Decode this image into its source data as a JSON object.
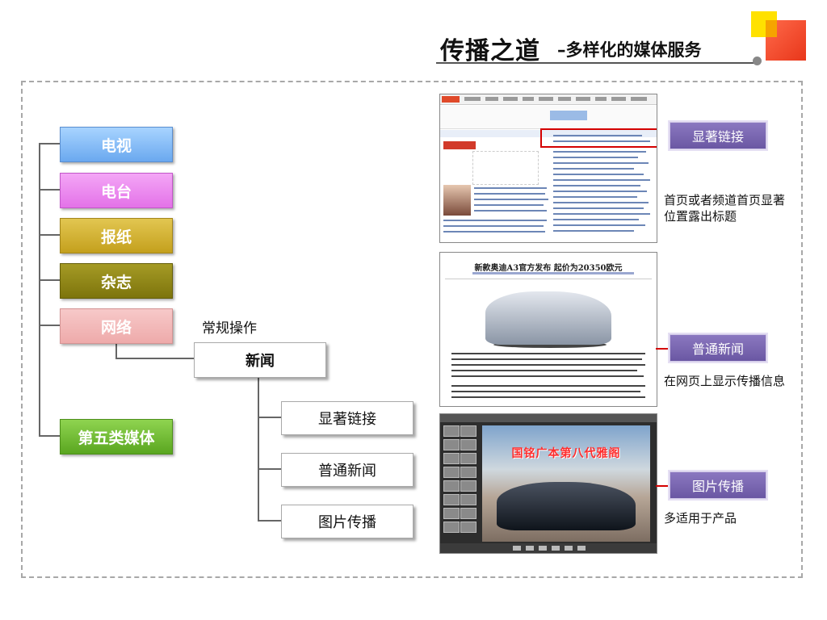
{
  "title": {
    "main": "传播之道",
    "sub": "–多样化的媒体服务"
  },
  "categories": {
    "tv": "电视",
    "radio": "电台",
    "newspaper": "报纸",
    "magazine": "杂志",
    "internet": "网络",
    "fifth": "第五类媒体"
  },
  "operation_label": "常规操作",
  "news_box": "新闻",
  "sub_items": {
    "prominent_link": "显著链接",
    "general_news": "普通新闻",
    "image_spread": "图片传播"
  },
  "screenshots": {
    "article_title": "新款奥迪A3官方发布 起价为20350欧元",
    "gallery_banner": "国铭广本第八代雅阁"
  },
  "tags": {
    "prominent_link": "显著链接",
    "general_news": "普通新闻",
    "image_spread": "图片传播"
  },
  "descriptions": {
    "prominent_link": "首页或者频道首页显著位置露出标题",
    "general_news": "在网页上显示传播信息",
    "image_spread": "多适用于产品"
  },
  "colors": {
    "tv": "#6aa8ef",
    "radio": "#e372e8",
    "newspaper": "#c4a01d",
    "magazine": "#7d740c",
    "internet": "#eeaaaa",
    "fifth": "#5aa620",
    "tag": "#6a57a3",
    "highlight": "#d40000"
  }
}
